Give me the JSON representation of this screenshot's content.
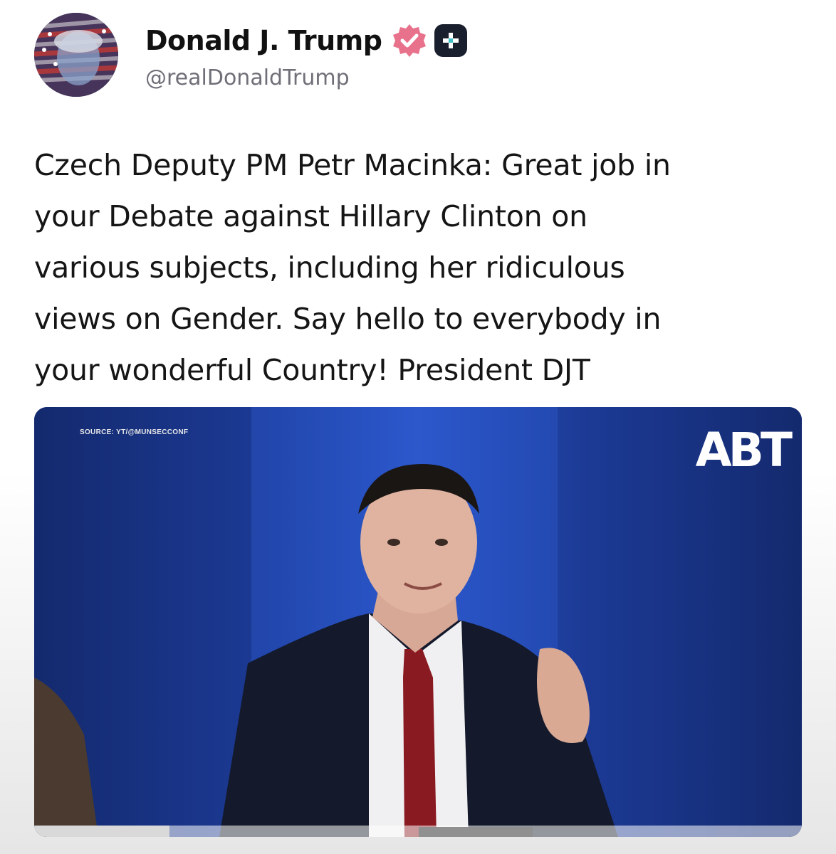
{
  "post": {
    "author": {
      "display_name": "Donald J. Trump",
      "handle": "@realDonaldTrump",
      "verified_icon": "verified-badge-icon",
      "membership_icon": "plus-badge-icon"
    },
    "text": "Czech Deputy PM Petr Macinka: Great job in\nyour Debate against Hillary Clinton on\nvarious subjects, including her ridiculous\nviews on Gender. Say hello to everybody in\nyour wonderful Country! President DJT",
    "media": {
      "type": "video",
      "source_label": "SOURCE: YT/@MUNSECCONF",
      "channel_logo": "ABT",
      "progress": 0.176
    }
  },
  "colors": {
    "verified_badge": "#e8728c",
    "plus_badge": "#1a1f2e",
    "media_background": "#1d3a8f",
    "handle_text": "#6f6f78"
  }
}
